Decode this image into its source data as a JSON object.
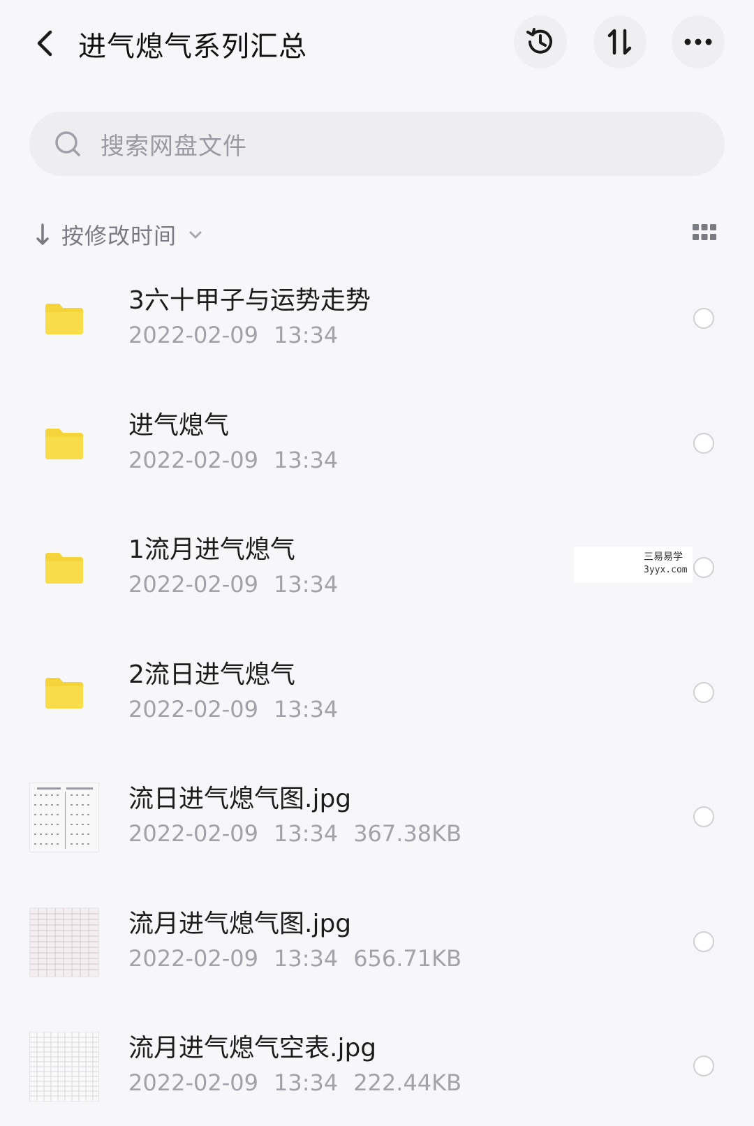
{
  "header": {
    "title": "进气熄气系列汇总",
    "icons": {
      "back": "chevron-left-icon",
      "history": "history-icon",
      "sort": "sort-arrows-icon",
      "more": "more-dots-icon"
    }
  },
  "search": {
    "placeholder": "搜索网盘文件"
  },
  "sort": {
    "label": "按修改时间"
  },
  "files": [
    {
      "name": "3六十甲子与运势走势",
      "date": "2022-02-09",
      "time": "13:34",
      "size": "",
      "type": "folder"
    },
    {
      "name": "进气熄气",
      "date": "2022-02-09",
      "time": "13:34",
      "size": "",
      "type": "folder"
    },
    {
      "name": "1流月进气熄气",
      "date": "2022-02-09",
      "time": "13:34",
      "size": "",
      "type": "folder"
    },
    {
      "name": "2流日进气熄气",
      "date": "2022-02-09",
      "time": "13:34",
      "size": "",
      "type": "folder"
    },
    {
      "name": "流日进气熄气图.jpg",
      "date": "2022-02-09",
      "time": "13:34",
      "size": "367.38KB",
      "type": "image"
    },
    {
      "name": "流月进气熄气图.jpg",
      "date": "2022-02-09",
      "time": "13:34",
      "size": "656.71KB",
      "type": "image"
    },
    {
      "name": "流月进气熄气空表.jpg",
      "date": "2022-02-09",
      "time": "13:34",
      "size": "222.44KB",
      "type": "image"
    }
  ],
  "watermark": {
    "line1": "三易易学",
    "line2": "3yyx.com"
  },
  "colors": {
    "folder": "#f5d33a",
    "background": "#f7f7f9",
    "muted": "#a2a2a8"
  }
}
